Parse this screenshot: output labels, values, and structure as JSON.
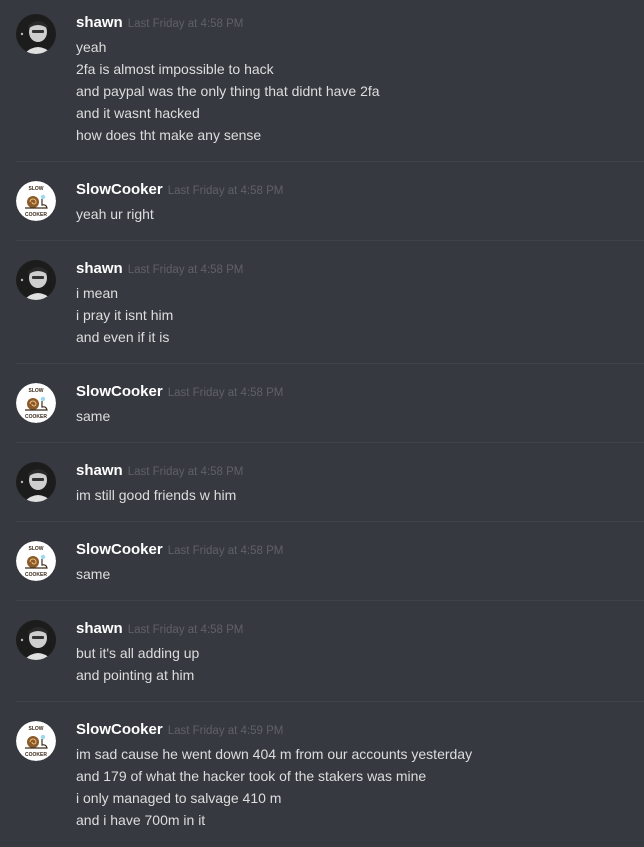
{
  "messages": [
    {
      "author": "shawn",
      "avatar": "shawn-avatar",
      "timestamp": "Last Friday at 4:58 PM",
      "lines": [
        "yeah",
        "2fa is almost impossible to hack",
        "and paypal was the only thing that didnt have 2fa",
        "and it wasnt hacked",
        "how does tht make any sense"
      ]
    },
    {
      "author": "SlowCooker",
      "avatar": "snail-avatar",
      "timestamp": "Last Friday at 4:58 PM",
      "lines": [
        "yeah ur right"
      ]
    },
    {
      "author": "shawn",
      "avatar": "shawn-avatar",
      "timestamp": "Last Friday at 4:58 PM",
      "lines": [
        "i mean",
        "i pray it isnt him",
        "and even if it is"
      ]
    },
    {
      "author": "SlowCooker",
      "avatar": "snail-avatar",
      "timestamp": "Last Friday at 4:58 PM",
      "lines": [
        "same"
      ]
    },
    {
      "author": "shawn",
      "avatar": "shawn-avatar",
      "timestamp": "Last Friday at 4:58 PM",
      "lines": [
        "im still good friends w him"
      ]
    },
    {
      "author": "SlowCooker",
      "avatar": "snail-avatar",
      "timestamp": "Last Friday at 4:58 PM",
      "lines": [
        "same"
      ]
    },
    {
      "author": "shawn",
      "avatar": "shawn-avatar",
      "timestamp": "Last Friday at 4:58 PM",
      "lines": [
        "but it's all adding up",
        "and pointing at him"
      ]
    },
    {
      "author": "SlowCooker",
      "avatar": "snail-avatar",
      "timestamp": "Last Friday at 4:59 PM",
      "lines": [
        "im sad cause he went down 404 m from our accounts yesterday",
        "and 179 of what the hacker took of the stakers was mine",
        "i only managed to salvage 410 m",
        "and i have 700m in it"
      ]
    }
  ],
  "avatars": {
    "shawn-avatar": {
      "bg": "#1a1a1a",
      "fg": "#d8d8d8"
    },
    "snail-avatar": {
      "bg": "#ffffff",
      "fg": "#3a2a1a"
    }
  },
  "snail_logo_text": {
    "top": "SLOW",
    "bottom": "COOKER"
  },
  "colors": {
    "background": "#36393f",
    "username": "#ffffff",
    "timestamp": "#5f6167",
    "text": "#dcddde",
    "divider": "#40434a"
  }
}
